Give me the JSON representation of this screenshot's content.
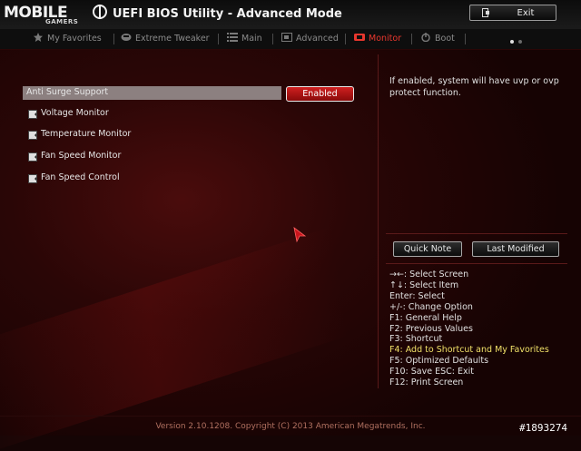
{
  "header": {
    "logo_main": "MOBILE",
    "logo_sub": "GAMERS",
    "title": "UEFI BIOS Utility - Advanced Mode",
    "exit_label": "Exit"
  },
  "tabs": [
    {
      "label": "My Favorites",
      "icon": "star-icon"
    },
    {
      "label": "Extreme Tweaker",
      "icon": "tweaker-icon"
    },
    {
      "label": "Main",
      "icon": "list-icon"
    },
    {
      "label": "Advanced",
      "icon": "advanced-icon"
    },
    {
      "label": "Monitor",
      "icon": "monitor-icon",
      "active": true
    },
    {
      "label": "Boot",
      "icon": "power-icon"
    }
  ],
  "settings": {
    "anti_surge_label": "Anti Surge Support",
    "anti_surge_value": "Enabled",
    "submenus": [
      "Voltage Monitor",
      "Temperature Monitor",
      "Fan Speed Monitor",
      "Fan Speed Control"
    ]
  },
  "help": {
    "text": "If enabled, system will have uvp or ovp protect function."
  },
  "side_buttons": {
    "quick_note": "Quick Note",
    "last_modified": "Last Modified"
  },
  "keys": [
    "→←: Select Screen",
    "↑↓: Select Item",
    "Enter: Select",
    "+/-: Change Option",
    "F1: General Help",
    "F2: Previous Values",
    "F3: Shortcut",
    "F4: Add to Shortcut and My Favorites",
    "F5: Optimized Defaults",
    "F10: Save  ESC: Exit",
    "F12: Print Screen"
  ],
  "footer": "Version 2.10.1208. Copyright (C) 2013 American Megatrends, Inc.",
  "watermark": "#1893274",
  "colors": {
    "accent": "#e8372e",
    "highlight_row": "#8c8080",
    "key_highlight": "#f0e068"
  }
}
